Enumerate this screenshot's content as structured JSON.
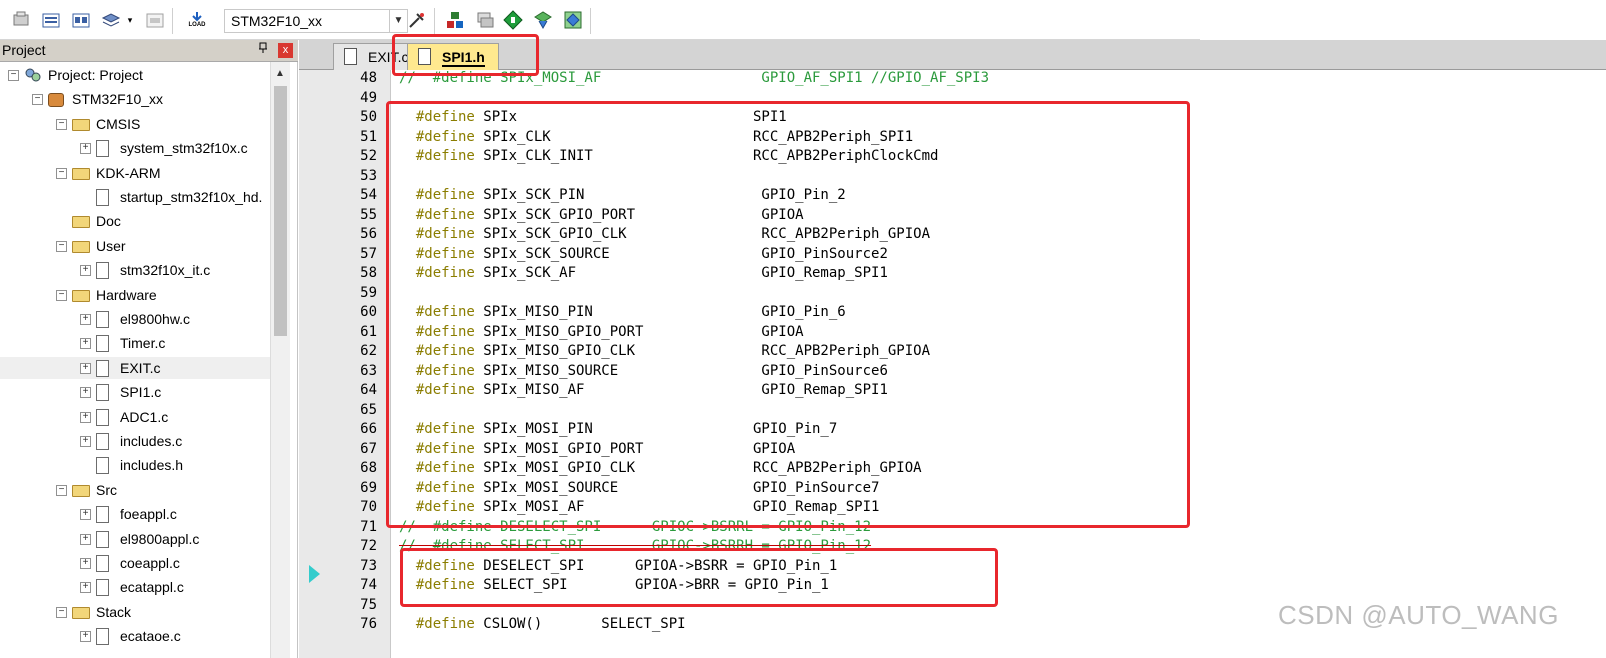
{
  "toolbar": {
    "target": "STM32F10_xx",
    "load_label": "LOAD",
    "icons": [
      "translate-icon",
      "build-icon",
      "rebuild-icon",
      "batch-build-icon",
      "stop-build-icon",
      "download-icon",
      "target-options-icon",
      "manage-components-icon",
      "select-packs-icon",
      "pack-installer-icon",
      "event-recorder-icon",
      "magic-wand-icon"
    ]
  },
  "project": {
    "title": "Project",
    "pin": "ᴾ",
    "close": "x",
    "tree": [
      {
        "label": "Project: Project",
        "level": 0,
        "kind": "project",
        "expander": "−"
      },
      {
        "label": "STM32F10_xx",
        "level": 1,
        "kind": "target",
        "expander": "−"
      },
      {
        "label": "CMSIS",
        "level": 2,
        "kind": "folder",
        "expander": "−"
      },
      {
        "label": "system_stm32f10x.c",
        "level": 3,
        "kind": "file",
        "expander": "+"
      },
      {
        "label": "KDK-ARM",
        "level": 2,
        "kind": "folder",
        "expander": "−"
      },
      {
        "label": "startup_stm32f10x_hd.",
        "level": 3,
        "kind": "file",
        "expander": ""
      },
      {
        "label": "Doc",
        "level": 2,
        "kind": "folder",
        "expander": ""
      },
      {
        "label": "User",
        "level": 2,
        "kind": "folder",
        "expander": "−"
      },
      {
        "label": "stm32f10x_it.c",
        "level": 3,
        "kind": "file",
        "expander": "+"
      },
      {
        "label": "Hardware",
        "level": 2,
        "kind": "folder",
        "expander": "−"
      },
      {
        "label": "el9800hw.c",
        "level": 3,
        "kind": "file",
        "expander": "+"
      },
      {
        "label": "Timer.c",
        "level": 3,
        "kind": "file",
        "expander": "+"
      },
      {
        "label": "EXIT.c",
        "level": 3,
        "kind": "file",
        "expander": "+",
        "selected": true
      },
      {
        "label": "SPI1.c",
        "level": 3,
        "kind": "file",
        "expander": "+"
      },
      {
        "label": "ADC1.c",
        "level": 3,
        "kind": "file",
        "expander": "+"
      },
      {
        "label": "includes.c",
        "level": 3,
        "kind": "file",
        "expander": "+"
      },
      {
        "label": "includes.h",
        "level": 3,
        "kind": "file",
        "expander": ""
      },
      {
        "label": "Src",
        "level": 2,
        "kind": "folder",
        "expander": "−"
      },
      {
        "label": "foeappl.c",
        "level": 3,
        "kind": "file",
        "expander": "+"
      },
      {
        "label": "el9800appl.c",
        "level": 3,
        "kind": "file",
        "expander": "+"
      },
      {
        "label": "coeappl.c",
        "level": 3,
        "kind": "file",
        "expander": "+"
      },
      {
        "label": "ecatappl.c",
        "level": 3,
        "kind": "file",
        "expander": "+"
      },
      {
        "label": "Stack",
        "level": 2,
        "kind": "folder",
        "expander": "−"
      },
      {
        "label": "ecataoe.c",
        "level": 3,
        "kind": "file",
        "expander": "+"
      }
    ]
  },
  "tabs": [
    {
      "label": "EXIT.c",
      "active": false
    },
    {
      "label": "SPI1.h",
      "active": true
    }
  ],
  "code": [
    {
      "n": "48",
      "segments": [
        {
          "t": "//  #define SPIx_MOSI_AF                   GPIO_AF_SPI1 //GPIO_AF_SPI3",
          "c": "cm"
        }
      ]
    },
    {
      "n": "49",
      "segments": []
    },
    {
      "n": "50",
      "segments": [
        {
          "t": "  #define",
          "c": "pp"
        },
        {
          "t": " SPIx                            SPI1",
          "c": ""
        }
      ]
    },
    {
      "n": "51",
      "segments": [
        {
          "t": "  #define",
          "c": "pp"
        },
        {
          "t": " SPIx_CLK                        RCC_APB2Periph_SPI1",
          "c": ""
        }
      ]
    },
    {
      "n": "52",
      "segments": [
        {
          "t": "  #define",
          "c": "pp"
        },
        {
          "t": " SPIx_CLK_INIT                   RCC_APB2PeriphClockCmd",
          "c": ""
        }
      ]
    },
    {
      "n": "53",
      "segments": []
    },
    {
      "n": "54",
      "segments": [
        {
          "t": "  #define",
          "c": "pp"
        },
        {
          "t": " SPIx_SCK_PIN                     GPIO_Pin_2",
          "c": ""
        }
      ]
    },
    {
      "n": "55",
      "segments": [
        {
          "t": "  #define",
          "c": "pp"
        },
        {
          "t": " SPIx_SCK_GPIO_PORT               GPIOA",
          "c": ""
        }
      ]
    },
    {
      "n": "56",
      "segments": [
        {
          "t": "  #define",
          "c": "pp"
        },
        {
          "t": " SPIx_SCK_GPIO_CLK                RCC_APB2Periph_GPIOA",
          "c": ""
        }
      ]
    },
    {
      "n": "57",
      "segments": [
        {
          "t": "  #define",
          "c": "pp"
        },
        {
          "t": " SPIx_SCK_SOURCE                  GPIO_PinSource2",
          "c": ""
        }
      ]
    },
    {
      "n": "58",
      "segments": [
        {
          "t": "  #define",
          "c": "pp"
        },
        {
          "t": " SPIx_SCK_AF                      GPIO_Remap_SPI1",
          "c": ""
        }
      ]
    },
    {
      "n": "59",
      "segments": []
    },
    {
      "n": "60",
      "segments": [
        {
          "t": "  #define",
          "c": "pp"
        },
        {
          "t": " SPIx_MISO_PIN                    GPIO_Pin_6",
          "c": ""
        }
      ]
    },
    {
      "n": "61",
      "segments": [
        {
          "t": "  #define",
          "c": "pp"
        },
        {
          "t": " SPIx_MISO_GPIO_PORT              GPIOA",
          "c": ""
        }
      ]
    },
    {
      "n": "62",
      "segments": [
        {
          "t": "  #define",
          "c": "pp"
        },
        {
          "t": " SPIx_MISO_GPIO_CLK               RCC_APB2Periph_GPIOA",
          "c": ""
        }
      ]
    },
    {
      "n": "63",
      "segments": [
        {
          "t": "  #define",
          "c": "pp"
        },
        {
          "t": " SPIx_MISO_SOURCE                 GPIO_PinSource6",
          "c": ""
        }
      ]
    },
    {
      "n": "64",
      "segments": [
        {
          "t": "  #define",
          "c": "pp"
        },
        {
          "t": " SPIx_MISO_AF                     GPIO_Remap_SPI1",
          "c": ""
        }
      ]
    },
    {
      "n": "65",
      "segments": []
    },
    {
      "n": "66",
      "segments": [
        {
          "t": "  #define",
          "c": "pp"
        },
        {
          "t": " SPIx_MOSI_PIN                   GPIO_Pin_7",
          "c": ""
        }
      ]
    },
    {
      "n": "67",
      "segments": [
        {
          "t": "  #define",
          "c": "pp"
        },
        {
          "t": " SPIx_MOSI_GPIO_PORT             GPIOA",
          "c": ""
        }
      ]
    },
    {
      "n": "68",
      "segments": [
        {
          "t": "  #define",
          "c": "pp"
        },
        {
          "t": " SPIx_MOSI_GPIO_CLK              RCC_APB2Periph_GPIOA",
          "c": ""
        }
      ]
    },
    {
      "n": "69",
      "segments": [
        {
          "t": "  #define",
          "c": "pp"
        },
        {
          "t": " SPIx_MOSI_SOURCE                GPIO_PinSource7",
          "c": ""
        }
      ]
    },
    {
      "n": "70",
      "segments": [
        {
          "t": "  #define",
          "c": "pp"
        },
        {
          "t": " SPIx_MOSI_AF                    GPIO_Remap_SPI1",
          "c": ""
        }
      ]
    },
    {
      "n": "71",
      "segments": [
        {
          "t": "//  #define DESELECT_SPI      GPIOC->BSRRL = GPIO_Pin_12",
          "c": "cm-strike"
        }
      ]
    },
    {
      "n": "72",
      "segments": [
        {
          "t": "//  #define SELECT_SPI        GPIOC->BSRRH = GPIO_Pin_12",
          "c": "cm-strike"
        }
      ]
    },
    {
      "n": "73",
      "segments": [
        {
          "t": "  #define",
          "c": "pp"
        },
        {
          "t": " DESELECT_SPI      GPIOA->BSRR = GPIO_Pin_1",
          "c": ""
        }
      ]
    },
    {
      "n": "74",
      "segments": [
        {
          "t": "  #define",
          "c": "pp"
        },
        {
          "t": " SELECT_SPI        GPIOA->BRR = GPIO_Pin_1",
          "c": ""
        }
      ]
    },
    {
      "n": "75",
      "segments": []
    },
    {
      "n": "76",
      "segments": [
        {
          "t": "  #define",
          "c": "pp"
        },
        {
          "t": " CSLOW()       SELECT_SPI",
          "c": ""
        }
      ]
    }
  ],
  "watermark": "CSDN @AUTO_WANG",
  "colors": {
    "annotation": "#e8272d",
    "active_tab": "#ffe98f",
    "comment": "#2b9a3c",
    "preprocessor": "#8b7d00"
  }
}
